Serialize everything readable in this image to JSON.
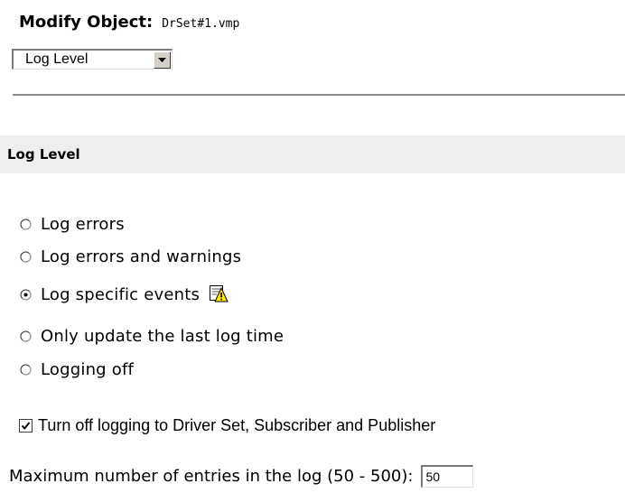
{
  "header": {
    "label": "Modify Object:",
    "object_name": "DrSet#1.vmp"
  },
  "object_select": {
    "selected": "Log Level"
  },
  "section": {
    "title": "Log Level"
  },
  "log_options": [
    {
      "label": "Log errors",
      "selected": false
    },
    {
      "label": "Log errors and warnings",
      "selected": false
    },
    {
      "label": "Log specific events",
      "selected": true,
      "icon": "event-log-warning-icon"
    },
    {
      "label": "Only update the last log time",
      "selected": false
    },
    {
      "label": "Logging off",
      "selected": false
    }
  ],
  "turn_off_logging": {
    "label": "Turn off logging to Driver Set, Subscriber and Publisher",
    "checked": true
  },
  "max_entries": {
    "label": "Maximum number of entries in the log (50 - 500):",
    "value": "50"
  }
}
